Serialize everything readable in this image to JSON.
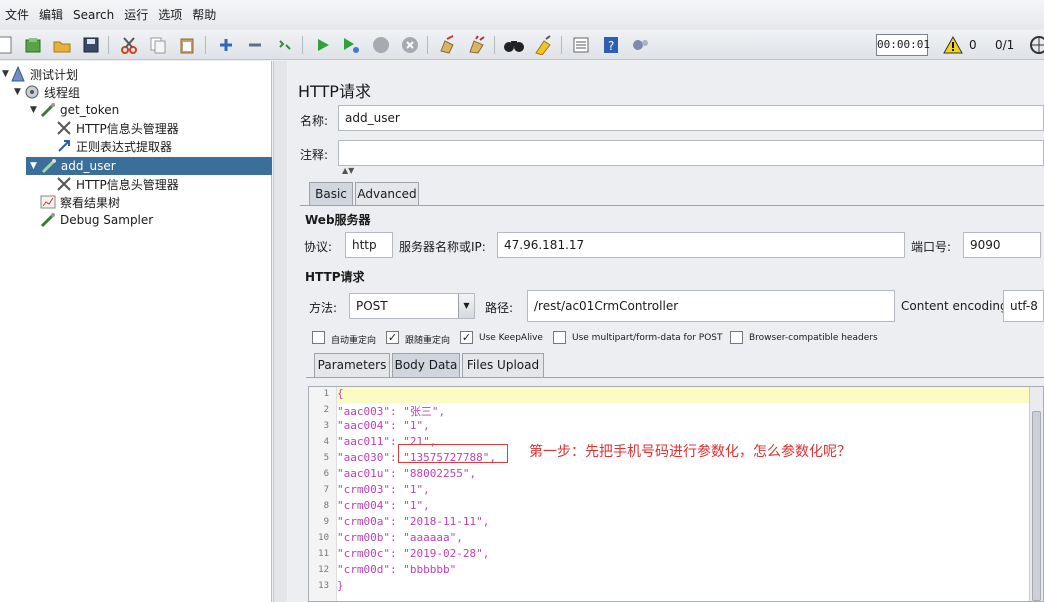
{
  "menu": [
    "文件",
    "编辑",
    "Search",
    "运行",
    "选项",
    "帮助"
  ],
  "toolbar": {
    "timer": "00:00:01",
    "warning_count": "0",
    "threads": "0/1"
  },
  "tree": {
    "test_plan": "测试计划",
    "thread_group": "线程组",
    "get_token": "get_token",
    "header_manager_1": "HTTP信息头管理器",
    "regex_extractor": "正则表达式提取器",
    "add_user": "add_user",
    "header_manager_2": "HTTP信息头管理器",
    "results_tree": "察看结果树",
    "debug_sampler": "Debug Sampler"
  },
  "panel": {
    "title": "HTTP请求",
    "name_label": "名称:",
    "name_value": "add_user",
    "comment_label": "注释:",
    "comment_value": "",
    "tabs": [
      "Basic",
      "Advanced"
    ],
    "web_server_title": "Web服务器",
    "protocol_label": "协议:",
    "protocol_value": "http",
    "server_label": "服务器名称或IP:",
    "server_value": "47.96.181.17",
    "port_label": "端口号:",
    "port_value": "9090",
    "http_request_title": "HTTP请求",
    "method_label": "方法:",
    "method_value": "POST",
    "path_label": "路径:",
    "path_value": "/rest/ac01CrmController",
    "encoding_label": "Content encoding:",
    "encoding_value": "utf-8",
    "checkboxes": [
      {
        "label": "自动重定向",
        "checked": false
      },
      {
        "label": "跟随重定向",
        "checked": true
      },
      {
        "label": "Use KeepAlive",
        "checked": true
      },
      {
        "label": "Use multipart/form-data for POST",
        "checked": false
      },
      {
        "label": "Browser-compatible headers",
        "checked": false
      }
    ],
    "sub_tabs": [
      "Parameters",
      "Body Data",
      "Files Upload"
    ]
  },
  "body_lines": [
    "{",
    "\"aac003\": \"张三\",",
    "\"aac004\": \"1\",",
    "\"aac011\": \"21\",",
    "\"aac030\": \"13575727788\",",
    "\"aac01u\": \"88002255\",",
    "\"crm003\": \"1\",",
    "\"crm004\": \"1\",",
    "\"crm00a\": \"2018-11-11\",",
    "\"crm00b\": \"aaaaaa\",",
    "\"crm00c\": \"2019-02-28\",",
    "\"crm00d\": \"bbbbbb\"",
    "}"
  ],
  "line_numbers": [
    "1",
    "2",
    "3",
    "4",
    "5",
    "6",
    "7",
    "8",
    "9",
    "10",
    "11",
    "12",
    "13"
  ],
  "annotation": "第一步：先把手机号码进行参数化，怎么参数化呢？",
  "colors": {
    "selection": "#3b6e98",
    "json_text": "#c040b8",
    "annotation": "#e03030",
    "current_line": "#fdfbc4"
  }
}
